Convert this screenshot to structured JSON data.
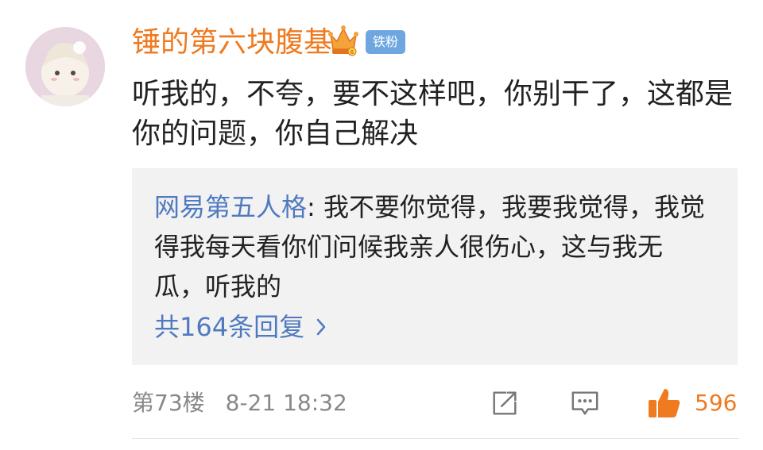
{
  "comment": {
    "username": "锤的第六块腹基",
    "badge": "铁粉",
    "text": "听我的，不夸，要不这样吧，你别干了，这都是你的问题，你自己解决",
    "floor": "第73楼",
    "time": "8-21 18:32",
    "likes": "596"
  },
  "reply": {
    "author": "网易第五人格",
    "separator": ": ",
    "text": "我不要你觉得，我要我觉得，我觉得我每天看你们问候我亲人很伤心，这与我无瓜，听我的",
    "count_label": "共164条回复"
  },
  "icons": {
    "crown": "crown-vip-icon",
    "share": "share-icon",
    "comment": "comment-icon",
    "like": "thumbs-up-icon",
    "chevron": "chevron-right-icon"
  },
  "colors": {
    "username": "#ef7a1f",
    "badge_bg": "#6ea7e0",
    "reply_author": "#4f7ac0",
    "reply_bg": "#f2f2f2",
    "like": "#ef7a1f"
  }
}
